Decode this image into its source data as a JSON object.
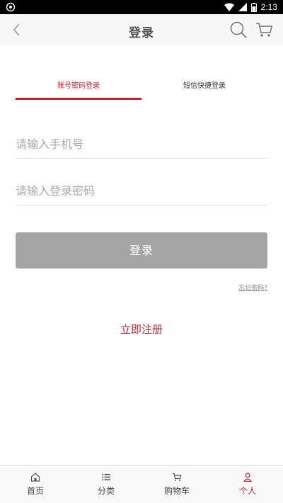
{
  "status_bar": {
    "time": "2:13"
  },
  "header": {
    "title": "登录"
  },
  "tabs": [
    {
      "label": "账号密码登录"
    },
    {
      "label": "短信快捷登录"
    }
  ],
  "form": {
    "phone_placeholder": "请输入手机号",
    "password_placeholder": "请输入登录密码"
  },
  "login_button": "登录",
  "forgot_password": "忘记密码?",
  "register": "立即注册",
  "bottom_nav": [
    {
      "label": "首页",
      "icon": "home-icon"
    },
    {
      "label": "分类",
      "icon": "list-icon"
    },
    {
      "label": "购物车",
      "icon": "cart-icon"
    },
    {
      "label": "个人",
      "icon": "user-icon",
      "active": true
    }
  ],
  "colors": {
    "accent": "#c0242b",
    "button_disabled": "#a4a4a4"
  }
}
